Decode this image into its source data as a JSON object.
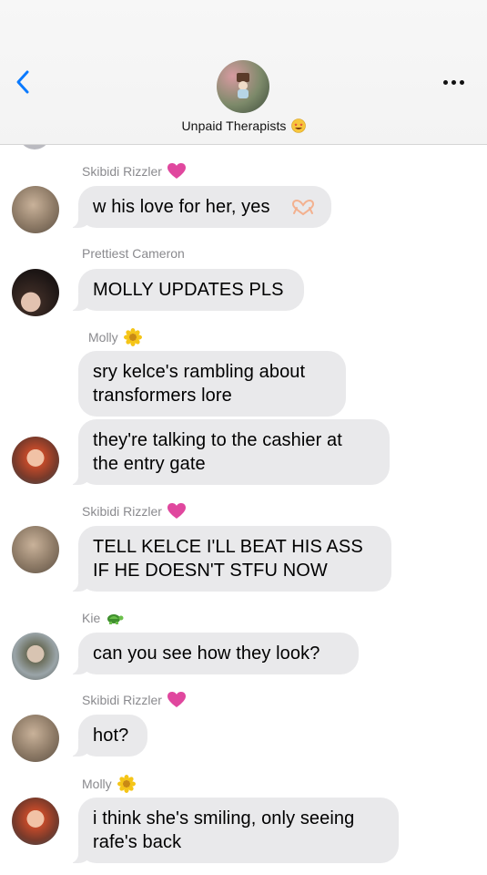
{
  "header": {
    "back_label": "back",
    "group_name": "Unpaid Therapists",
    "group_emoji": "star-struck-face-emoji",
    "more_label": "more-options"
  },
  "colors": {
    "accent": "#0a7aff",
    "bubble": "#e9e9eb",
    "sender": "#8a8a8e",
    "heart": "#e0479e",
    "flower": "#f5c518"
  },
  "messages": [
    {
      "sender": "Skibidi Rizzler",
      "sender_icon": "pink-heart-icon",
      "text": "w his love for her, yes",
      "trail_icon": "heart-hands-icon",
      "avatar": "dog-avatar"
    },
    {
      "sender": "Prettiest Cameron",
      "sender_icon": "",
      "text": "MOLLY UPDATES PLS",
      "avatar": "dark-hair-avatar"
    },
    {
      "sender": "Molly",
      "sender_icon": "sunflower-icon",
      "text": "sry kelce's rambling about transformers lore",
      "avatar": ""
    },
    {
      "sender": "",
      "sender_icon": "",
      "text": "they're talking to the cashier at the entry gate",
      "avatar": "red-hair-avatar"
    },
    {
      "sender": "Skibidi Rizzler",
      "sender_icon": "pink-heart-icon",
      "text": "TELL KELCE I'LL BEAT HIS ASS IF HE DOESN'T STFU NOW",
      "avatar": "dog-avatar"
    },
    {
      "sender": "Kie",
      "sender_icon": "turtle-icon",
      "text": "can you see how they look?",
      "avatar": "kie-avatar"
    },
    {
      "sender": "Skibidi Rizzler",
      "sender_icon": "pink-heart-icon",
      "text": "hot?",
      "avatar": "dog-avatar"
    },
    {
      "sender": "Molly",
      "sender_icon": "sunflower-icon",
      "text": "i think she's smiling, only seeing rafe's back",
      "avatar": "red-hair-avatar"
    }
  ],
  "text_lines": {
    "m0": [
      "w his love for her, yes"
    ],
    "m1": [
      "MOLLY UPDATES PLS"
    ],
    "m2": [
      "sry kelce's rambling about",
      "transformers lore"
    ],
    "m3": [
      "they're talking to the cashier at",
      "the entry gate"
    ],
    "m4": [
      "TELL KELCE I'LL BEAT HIS ASS",
      "IF HE DOESN'T STFU NOW"
    ],
    "m5": [
      "can you see how they look?"
    ],
    "m6": [
      "hot?"
    ],
    "m7": [
      "i think she's smiling, only seeing",
      "rafe's back"
    ]
  }
}
